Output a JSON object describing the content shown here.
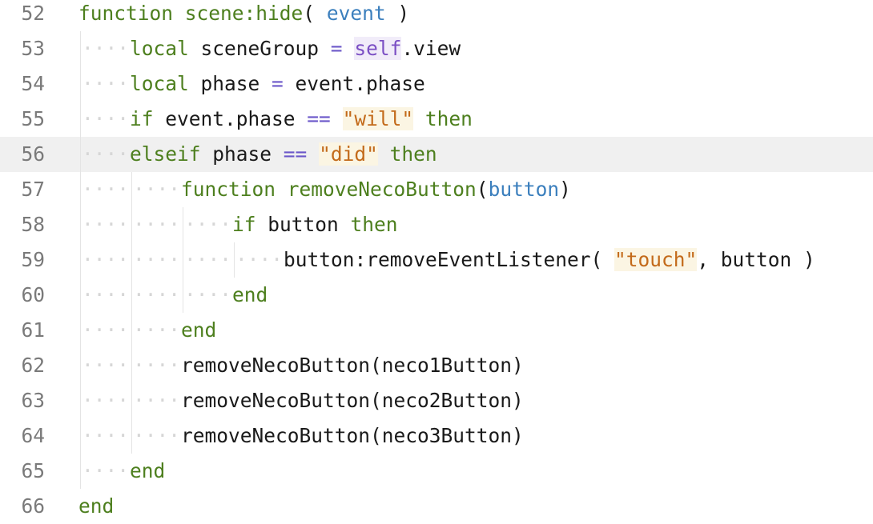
{
  "editor": {
    "current_line": 56,
    "colors": {
      "keyword": "#4d7f1e",
      "parameter": "#3b7fbd",
      "operator": "#6b57c9",
      "string": "#c36a1a",
      "text": "#1a1a1a",
      "line_number": "#7a7a7a",
      "current_line_bg": "#f0f0f0"
    },
    "lines": [
      {
        "n": "52",
        "indent": 0,
        "tokens": [
          [
            "kw",
            "function"
          ],
          [
            "tok",
            " "
          ],
          [
            "fn",
            "scene:hide"
          ],
          [
            "tok",
            "( "
          ],
          [
            "param",
            "event"
          ],
          [
            "tok",
            " )"
          ]
        ]
      },
      {
        "n": "53",
        "indent": 1,
        "tokens": [
          [
            "kw",
            "local"
          ],
          [
            "tok",
            " sceneGroup "
          ],
          [
            "op",
            "="
          ],
          [
            "tok",
            " "
          ],
          [
            "self",
            "self"
          ],
          [
            "tok",
            ".view"
          ]
        ]
      },
      {
        "n": "54",
        "indent": 1,
        "tokens": [
          [
            "kw",
            "local"
          ],
          [
            "tok",
            " phase "
          ],
          [
            "op",
            "="
          ],
          [
            "tok",
            " event.phase"
          ]
        ]
      },
      {
        "n": "55",
        "indent": 1,
        "tokens": [
          [
            "kw",
            "if"
          ],
          [
            "tok",
            " event.phase "
          ],
          [
            "op",
            "=="
          ],
          [
            "tok",
            " "
          ],
          [
            "str",
            "\"will\""
          ],
          [
            "tok",
            " "
          ],
          [
            "kw",
            "then"
          ]
        ]
      },
      {
        "n": "56",
        "indent": 1,
        "tokens": [
          [
            "kw",
            "elseif"
          ],
          [
            "tok",
            " phase "
          ],
          [
            "op",
            "=="
          ],
          [
            "tok",
            " "
          ],
          [
            "str",
            "\"did\""
          ],
          [
            "tok",
            " "
          ],
          [
            "kw",
            "then"
          ]
        ]
      },
      {
        "n": "57",
        "indent": 2,
        "tokens": [
          [
            "kw",
            "function"
          ],
          [
            "tok",
            " "
          ],
          [
            "fn",
            "removeNecoButton"
          ],
          [
            "tok",
            "("
          ],
          [
            "param",
            "button"
          ],
          [
            "tok",
            ")"
          ]
        ]
      },
      {
        "n": "58",
        "indent": 3,
        "tokens": [
          [
            "kw",
            "if"
          ],
          [
            "tok",
            " button "
          ],
          [
            "kw",
            "then"
          ]
        ]
      },
      {
        "n": "59",
        "indent": 4,
        "tokens": [
          [
            "tok",
            "button:removeEventListener( "
          ],
          [
            "str",
            "\"touch\""
          ],
          [
            "tok",
            ", button )"
          ]
        ]
      },
      {
        "n": "60",
        "indent": 3,
        "tokens": [
          [
            "kw",
            "end"
          ]
        ]
      },
      {
        "n": "61",
        "indent": 2,
        "tokens": [
          [
            "kw",
            "end"
          ]
        ]
      },
      {
        "n": "62",
        "indent": 2,
        "tokens": [
          [
            "tok",
            "removeNecoButton(neco1Button)"
          ]
        ]
      },
      {
        "n": "63",
        "indent": 2,
        "tokens": [
          [
            "tok",
            "removeNecoButton(neco2Button)"
          ]
        ]
      },
      {
        "n": "64",
        "indent": 2,
        "tokens": [
          [
            "tok",
            "removeNecoButton(neco3Button)"
          ]
        ]
      },
      {
        "n": "65",
        "indent": 1,
        "tokens": [
          [
            "kw",
            "end"
          ]
        ]
      },
      {
        "n": "66",
        "indent": 0,
        "tokens": [
          [
            "kw",
            "end"
          ]
        ]
      }
    ]
  }
}
